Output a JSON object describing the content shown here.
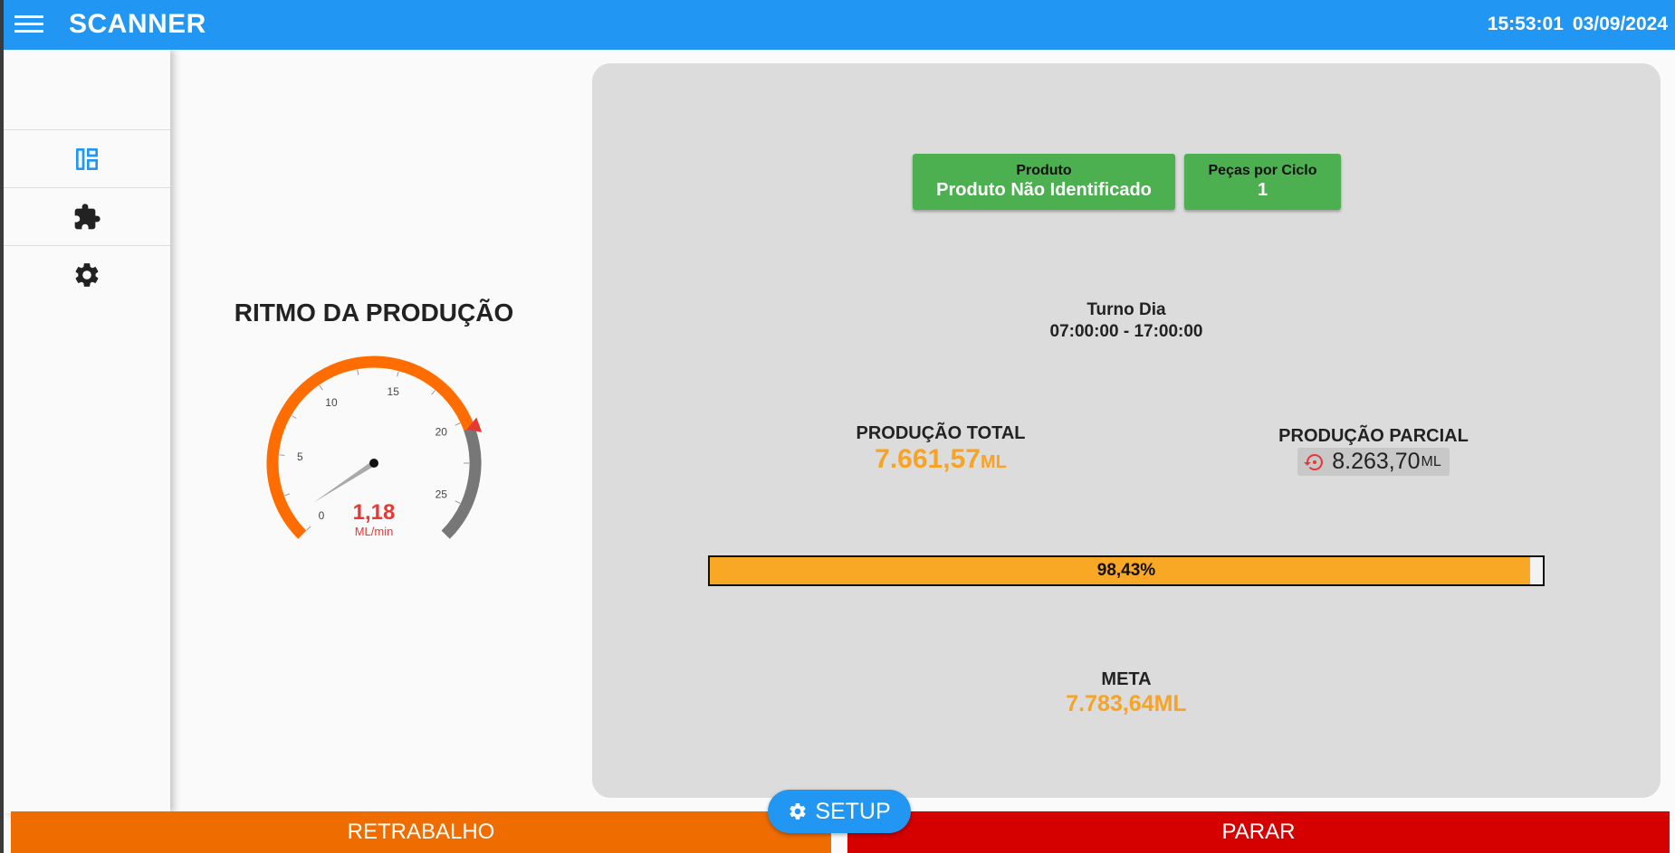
{
  "app": {
    "title": "SCANNER"
  },
  "clock": {
    "time": "15:53:01",
    "date": "03/09/2024"
  },
  "sidebar": {
    "items": [
      {
        "name": "dashboard",
        "icon": "dashboard-icon"
      },
      {
        "name": "extensions",
        "icon": "puzzle-icon"
      },
      {
        "name": "settings",
        "icon": "gear-icon"
      }
    ]
  },
  "gauge": {
    "title": "RITMO DA PRODUÇÃO",
    "value": 1.18,
    "value_text": "1,18",
    "unit": "ML/min",
    "min": 0,
    "max": 27,
    "ticks": [
      "0",
      "5",
      "10",
      "15",
      "20",
      "25"
    ],
    "threshold": 20.5,
    "colors": {
      "normal": "#ff6d00",
      "over": "#777777",
      "value": "#e53935",
      "marker": "#e53935"
    }
  },
  "product": {
    "label": "Produto",
    "value": "Produto Não Identificado"
  },
  "pieces": {
    "label": "Peças por Ciclo",
    "value": "1"
  },
  "shift": {
    "name": "Turno Dia",
    "hours": "07:00:00 - 17:00:00"
  },
  "production_total": {
    "label": "PRODUÇÃO TOTAL",
    "value": "7.661,57",
    "unit": "ML"
  },
  "production_partial": {
    "label": "PRODUÇÃO PARCIAL",
    "value": "8.263,70",
    "unit": "ML",
    "icon": "reset-icon"
  },
  "progress": {
    "percent": 98.43,
    "text": "98,43%"
  },
  "meta": {
    "label": "META",
    "value": "7.783,64ML"
  },
  "buttons": {
    "rework": "RETRABALHO",
    "stop": "PARAR",
    "setup": "SETUP"
  },
  "colors": {
    "topbar": "#2196f3",
    "product_box": "#4caf50",
    "accent": "#f7a325",
    "rework": "#ef6c00",
    "stop": "#d50000",
    "setup": "#2196f3"
  }
}
